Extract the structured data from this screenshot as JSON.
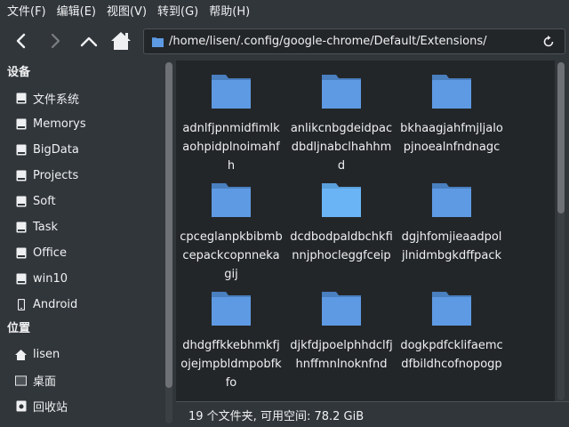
{
  "menubar": {
    "items": [
      "文件(F)",
      "编辑(E)",
      "视图(V)",
      "转到(G)",
      "帮助(H)"
    ]
  },
  "toolbar": {
    "back_icon": "back-arrow-icon",
    "forward_icon": "forward-arrow-icon",
    "up_icon": "up-arrow-icon",
    "home_icon": "home-icon",
    "path": "/home/lisen/.config/google-chrome/Default/Extensions/",
    "refresh_icon": "refresh-icon"
  },
  "sidebar": {
    "devices_header": "设备",
    "devices": [
      {
        "label": "文件系统",
        "icon": "drive-icon"
      },
      {
        "label": "Memorys",
        "icon": "drive-icon"
      },
      {
        "label": "BigData",
        "icon": "drive-icon"
      },
      {
        "label": "Projects",
        "icon": "drive-icon"
      },
      {
        "label": "Soft",
        "icon": "drive-icon"
      },
      {
        "label": "Task",
        "icon": "drive-icon"
      },
      {
        "label": "Office",
        "icon": "drive-icon"
      },
      {
        "label": "win10",
        "icon": "drive-icon"
      },
      {
        "label": "Android",
        "icon": "phone-icon"
      }
    ],
    "places_header": "位置",
    "places": [
      {
        "label": "lisen",
        "icon": "home-icon"
      },
      {
        "label": "桌面",
        "icon": "desktop-icon"
      },
      {
        "label": "回收站",
        "icon": "trash-icon"
      }
    ]
  },
  "folders": [
    {
      "name": "adnlfjpnmidfimlkaohpidplnoimahfh"
    },
    {
      "name": "anlikcnbgdeidpacdbdljnabclhahhmd"
    },
    {
      "name": "bkhaagjahfmjljalopjnoealnfndnagc"
    },
    {
      "name": "cpceglanpkbibmbcepackcopnnekagij"
    },
    {
      "name": "dcdbodpaldbchkfinnjphocleggfceip"
    },
    {
      "name": "dgjhfomjieaadpoljlnidmbgkdffpack"
    },
    {
      "name": "dhdgffkkebhmkfjojejmpbldmpobfkfo"
    },
    {
      "name": "djkfdjpoelphhdclfjhnffmnlnoknfnd"
    },
    {
      "name": "dogkpdfcklifaemcdfbildhcofnopogp"
    }
  ],
  "status": {
    "text": "19 个文件夹, 可用空间: 78.2 GiB"
  },
  "colors": {
    "window_bg": "#31363b",
    "view_bg": "#232629",
    "folder_blue": "#5e9ae3",
    "folder_highlight": "#6ab4f5",
    "text": "#eff0f1"
  }
}
